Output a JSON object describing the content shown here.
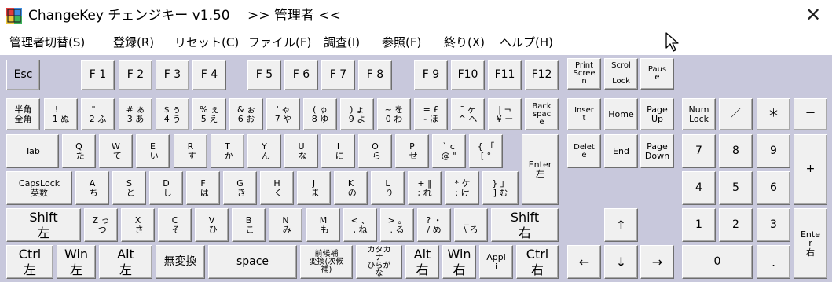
{
  "window": {
    "title": "ChangeKey チェンジキー v1.50 　>> 管理者 <<",
    "close_glyph": "✕"
  },
  "menu": [
    "管理者切替(S)",
    "登録(R)",
    "リセット(C)",
    "ファイル(F)",
    "調査(I)",
    "参照(F)",
    "終り(X)",
    "ヘルプ(H)"
  ],
  "keys": {
    "esc": "Esc",
    "f1": "F 1",
    "f2": "F 2",
    "f3": "F 3",
    "f4": "F 4",
    "f5": "F 5",
    "f6": "F 6",
    "f7": "F 7",
    "f8": "F 8",
    "f9": "F 9",
    "f10": "F10",
    "f11": "F11",
    "f12": "F12",
    "print_screen": "Print\nScree\nn",
    "scroll_lock": "Scrol\nl\nLock",
    "pause": "Paus\ne",
    "hankaku_zenkaku": "半角\n全角",
    "k1": "!　\n1 ぬ",
    "k2": "\"　\n2 ふ",
    "k3": "# ぁ\n3 あ",
    "k4": "$ ぅ\n4 う",
    "k5": "% ぇ\n5 え",
    "k6": "& ぉ\n6 お",
    "k7": "' ゃ\n7 や",
    "k8": "( ゅ\n8 ゆ",
    "k9": ") ょ\n9 よ",
    "k0": "~ を\n0 わ",
    "minus": "= £\n- ほ",
    "caret": "¯ ヶ\n^ へ",
    "yen": "| ¬\n¥ ー",
    "backspace": "Back\nspac\ne",
    "insert": "Inser\nt",
    "home": "Home",
    "page_up": "Page\nUp",
    "num_lock": "Num\nLock",
    "num_slash": "／",
    "num_star": "＊",
    "num_minus": "－",
    "tab": "Tab",
    "q": "Q\n た",
    "w": "W\n て",
    "e": "E\n い",
    "r": "R\n す",
    "t": "T\n か",
    "y": "Y\n ん",
    "u": "U\n な",
    "i": "I\n に",
    "o": "O\n ら",
    "p": "P\n せ",
    "at": "` ¢\n@ \"",
    "bracket": "{ 「\n[ °",
    "enter": "Enter\n左",
    "delete": "Delet\ne",
    "end": "End",
    "page_down": "Page\nDown",
    "num7": "7",
    "num8": "8",
    "num9": "9",
    "num_plus": "+",
    "caps": "CapsLock\n英数",
    "a": "A\n ち",
    "s": "S\n と",
    "d": "D\n し",
    "f": "F\n は",
    "g": "G\n き",
    "h": "H\n く",
    "j": "J\n ま",
    "k": "K\n の",
    "l": "L\n り",
    "semicolon": "+ ‖\n; れ",
    "colon": "* ケ\n: け",
    "rbracket": "} 」\n] む",
    "num4": "4",
    "num5": "5",
    "num6": "6",
    "shift_l": "Shift\n左",
    "z": "Z っ\n つ",
    "x": "X\n さ",
    "c": "C\n そ",
    "v": "V\n ひ",
    "b": "B\n こ",
    "n": "N\n み",
    "m": "M\n も",
    "comma": "< 、\n, ね",
    "period": "> 。\n. る",
    "slash": "? ・\n/ め",
    "backslash": "_　\n\\ ろ",
    "shift_r": "Shift\n右",
    "up": "↑",
    "num1": "1",
    "num2": "2",
    "num3": "3",
    "num_enter": "Ente\nr\n右",
    "ctrl_l": "Ctrl\n左",
    "win_l": "Win\n左",
    "alt_l": "Alt\n左",
    "muhenkan": "無変換",
    "space": "space",
    "henkan": "前候補\n変換(次候\n補)",
    "kana": "カタカ\nナ\nひらが\nな",
    "alt_r": "Alt\n右",
    "win_r": "Win\n右",
    "apps": "Appl\ni",
    "ctrl_r": "Ctrl\n右",
    "left": "←",
    "down": "↓",
    "right": "→",
    "num0": "0",
    "num_dot": "."
  }
}
